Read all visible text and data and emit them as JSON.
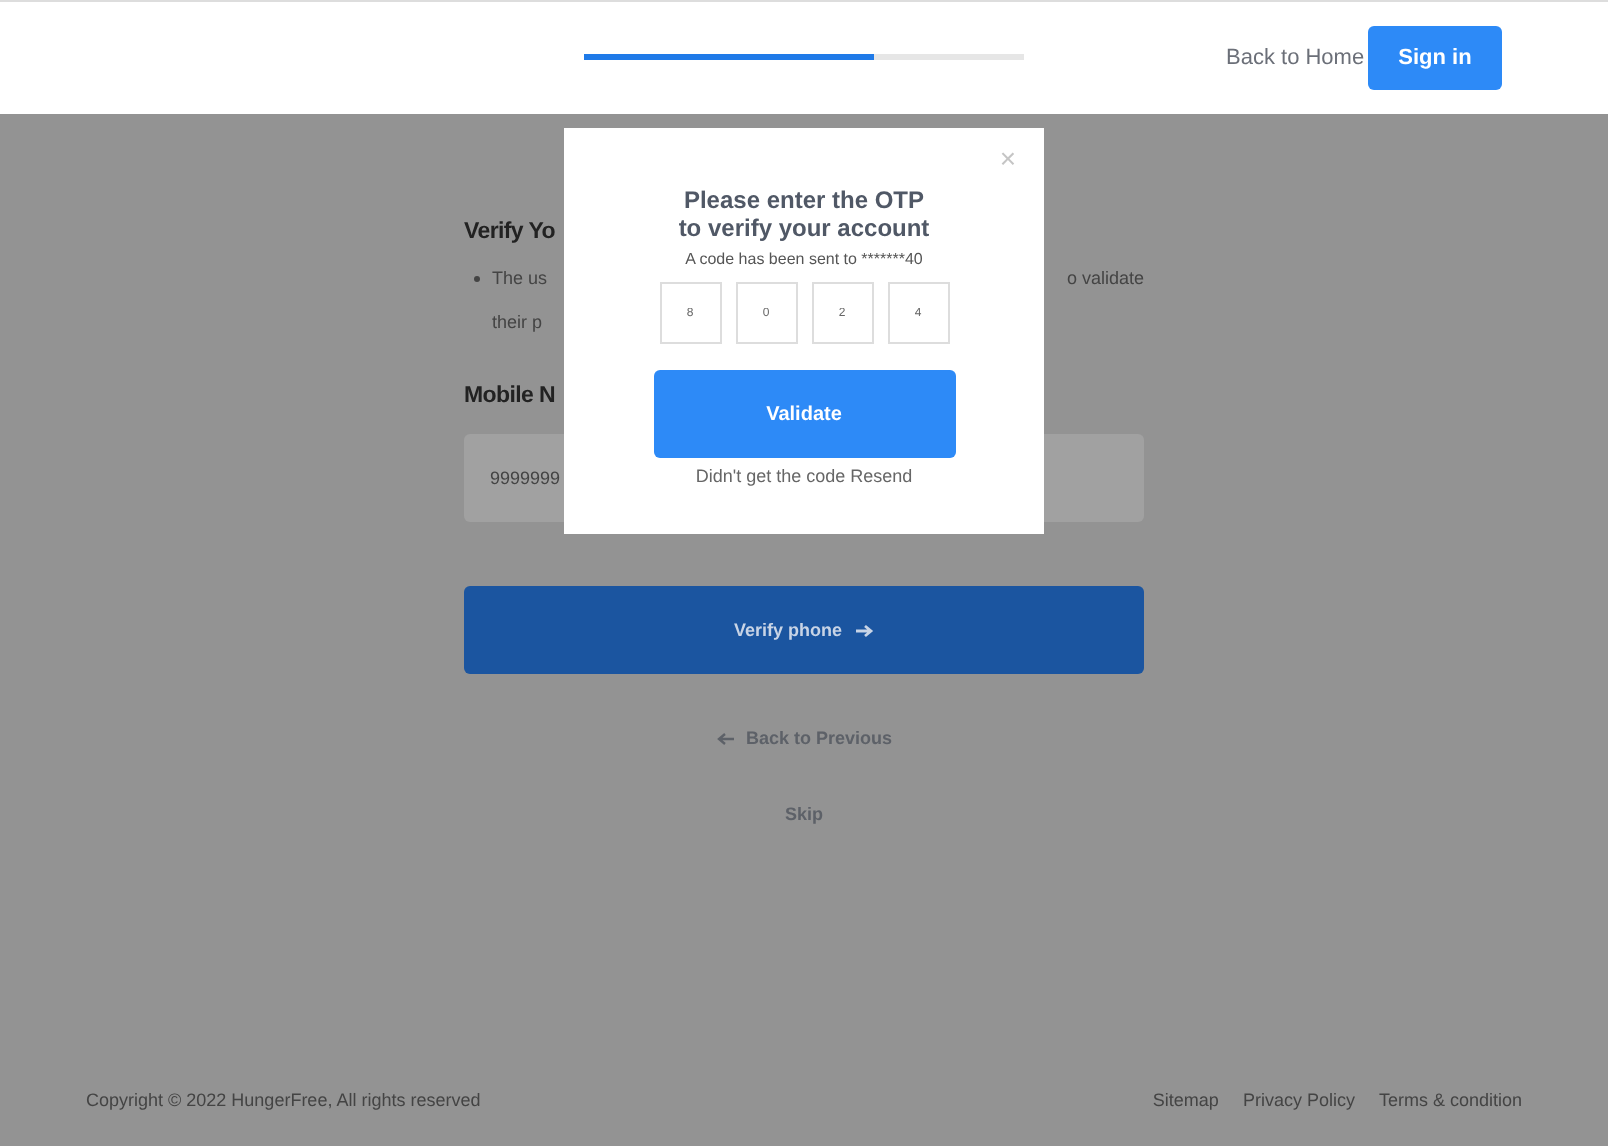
{
  "header": {
    "progress": {
      "level": 0.66
    },
    "back_link": "Back to Home",
    "sign_in": "Sign in"
  },
  "page": {
    "heading": "Verify Yo",
    "bullet_left_1": "The us",
    "bullet_right_1": "o validate",
    "bullet_left_2": "their p",
    "mobile_label": "Mobile N",
    "mobile_value": "9999999",
    "verify_button": "Verify phone",
    "back_previous": "Back to Previous",
    "skip": "Skip"
  },
  "modal": {
    "close": "×",
    "title_line_1": "Please enter the OTP",
    "title_line_2": "to verify your account",
    "subtitle": "A code has been sent to *******40",
    "otp_digits": [
      "8",
      "0",
      "2",
      "4"
    ],
    "validate": "Validate",
    "resend": "Didn't get the code Resend"
  },
  "footer": {
    "copyright": "Copyright © 2022 HungerFree, All rights reserved",
    "links": [
      "Sitemap",
      "Privacy Policy",
      "Terms & condition"
    ]
  }
}
